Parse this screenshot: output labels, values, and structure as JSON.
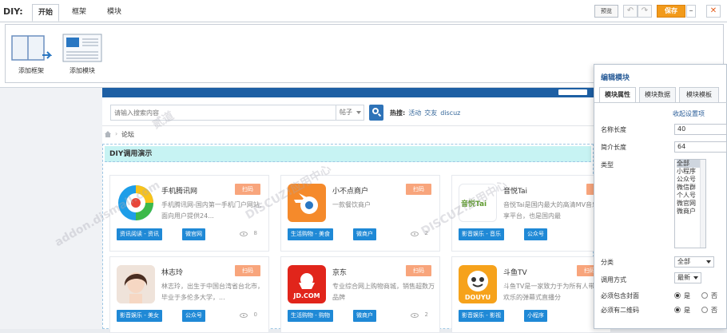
{
  "toolbar": {
    "label": "DIY:",
    "tabs": [
      "开始",
      "框架",
      "模块"
    ],
    "preview_label": "预览",
    "save_label": "保存",
    "undo_glyph": "↶",
    "redo_glyph": "↷",
    "close_glyph": "✕"
  },
  "tools": [
    {
      "label": "添加框架",
      "icon": "add-frame-icon"
    },
    {
      "label": "添加模块",
      "icon": "add-module-icon"
    }
  ],
  "site": {
    "search_placeholder": "请输入搜索内容",
    "search_type": "帖子",
    "hot_label": "热搜:",
    "hot_words": [
      "活动",
      "交友",
      "discuz"
    ],
    "breadcrumb": "论坛",
    "diy_block_title": "DIY调用演示",
    "scan_label": "扫码"
  },
  "cards": [
    {
      "name": "手机腾讯网",
      "desc": "手机腾讯网-国内第一手机门户网站,面向用户提供24...",
      "tags": [
        "资讯阅读 - 资讯",
        "微官网"
      ],
      "views": "8"
    },
    {
      "name": "小不点商户",
      "desc": "一款餐饮商户",
      "tags": [
        "生活购物 - 美食",
        "微商户"
      ],
      "views": "2"
    },
    {
      "name": "音悦Tai",
      "desc": "音悦Tai是国内最大的高清MV音乐分享平台，也是国内最",
      "tags": [
        "影音娱乐 - 音乐",
        "公众号"
      ],
      "views": ""
    },
    {
      "name": "林志玲",
      "desc": "林志玲，出生于中国台湾省台北市，毕业于多伦多大学，...",
      "tags": [
        "影音娱乐 - 美女",
        "公众号"
      ],
      "views": "0"
    },
    {
      "name": "京东",
      "desc": "专业综合网上购物商城，销售超数万品牌",
      "tags": [
        "生活购物 - 购物",
        "微商户"
      ],
      "views": "2"
    },
    {
      "name": "斗鱼TV",
      "desc": "斗鱼TV是一家致力于为所有人带来欢乐的弹幕式直播分",
      "tags": [
        "影音娱乐 - 影视",
        "小程序"
      ],
      "views": ""
    }
  ],
  "logos": {
    "qq": "",
    "blender": "",
    "yinyue": "音悦Tai",
    "jd": "JD.COM",
    "douyu": "DOUYU"
  },
  "edit_panel": {
    "title": "编辑模块",
    "tabs": [
      "模块属性",
      "模块数据",
      "模块模板"
    ],
    "collapse_link": "收起设置项",
    "fields": {
      "name_len_label": "名称长度",
      "name_len_value": "40",
      "intro_len_label": "简介长度",
      "intro_len_value": "64",
      "type_label": "类型",
      "type_options": [
        "全部",
        "小程序",
        "公众号",
        "微信群",
        "个人号",
        "微官网",
        "微商户"
      ],
      "category_label": "分类",
      "category_value": "全部",
      "call_mode_label": "调用方式",
      "call_mode_value": "最新",
      "must_cover_label": "必须包含封面",
      "must_qr_label": "必须有二维码",
      "yes": "是",
      "no": "否"
    }
  },
  "watermark": {
    "brand": "DISCUZ!应用中心",
    "site": "addon.dismall.com",
    "short": "贰道"
  },
  "colors": {
    "accent": "#f29a1a",
    "tag_blue": "#1f89d6",
    "scan_orange": "#f8a57c",
    "header_blue": "#1d5fa4"
  }
}
